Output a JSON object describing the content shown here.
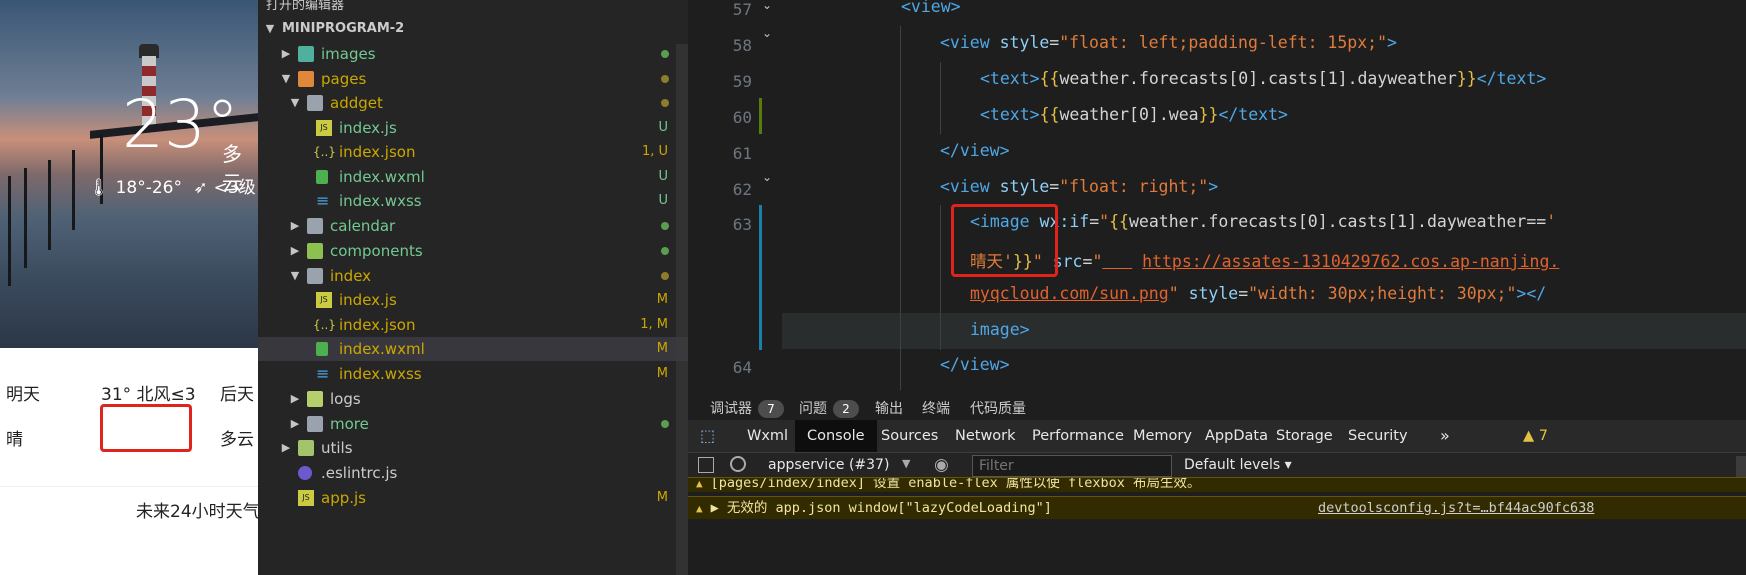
{
  "phone": {
    "temperature": "23°",
    "condition": "多云",
    "range": "18°-26°",
    "wind": "<3级",
    "tomorrow_label": "明天",
    "tomorrow_temp_wind": "31° 北风≤3",
    "dayafter_label": "后天",
    "tomorrow_weather": "晴",
    "dayafter_weather": "多云",
    "hourly_title": "未来24小时天气"
  },
  "explorer": {
    "open_editors": "打开的编辑器",
    "project": "MINIPROGRAM-2",
    "items": [
      {
        "name": "images",
        "badge": ""
      },
      {
        "name": "pages",
        "badge": ""
      },
      {
        "name": "addget",
        "badge": ""
      },
      {
        "name": "index.js",
        "badge": "U"
      },
      {
        "name": "index.json",
        "badge": "1, U"
      },
      {
        "name": "index.wxml",
        "badge": "U"
      },
      {
        "name": "index.wxss",
        "badge": "U"
      },
      {
        "name": "calendar",
        "badge": ""
      },
      {
        "name": "components",
        "badge": ""
      },
      {
        "name": "index",
        "badge": ""
      },
      {
        "name": "index.js",
        "badge": "M"
      },
      {
        "name": "index.json",
        "badge": "1, M"
      },
      {
        "name": "index.wxml",
        "badge": "M"
      },
      {
        "name": "index.wxss",
        "badge": "M"
      },
      {
        "name": "logs",
        "badge": ""
      },
      {
        "name": "more",
        "badge": ""
      },
      {
        "name": "utils",
        "badge": ""
      },
      {
        "name": ".eslintrc.js",
        "badge": ""
      },
      {
        "name": "app.js",
        "badge": "M"
      }
    ],
    "file_icons": {
      "js": "JS",
      "json": "{..}",
      "wxss": "≡"
    }
  },
  "editor": {
    "line_numbers": [
      "57",
      "58",
      "59",
      "60",
      "61",
      "62",
      "63",
      "64"
    ],
    "code": {
      "l57_view": "<view>",
      "l58_open": "<view",
      "l58_attr": "style",
      "l58_val": "\"float: left;padding-left: 15px;\"",
      "l59_text": "<text>",
      "l59_expr": "weather.forecasts[0].casts[1].dayweather",
      "l59_close": "</text>",
      "l60_expr": "weather[0].wea",
      "l61_close": "</view>",
      "l62_val": "\"float: right;\"",
      "l63_image": "<image",
      "l63_wxif": "wx:if",
      "l63_expr": "weather.forecasts[0].casts[1].dayweather==",
      "l63_lit": "'晴天'",
      "l63_src": "src",
      "l63_url1": "https://assates-1310429762.cos.ap-nanjing.",
      "l63_url2": "myqcloud.com/sun.png",
      "l63_style_val": "\"width: 30px;height: 30px;\"",
      "l63_close_a": "</",
      "l63_close_b": "image",
      "l64_close": "</view>",
      "brace_open": "{{",
      "brace_close": "}}",
      "eq": "=",
      "gt": ">",
      "quote": "\""
    }
  },
  "panel": {
    "tabs": [
      {
        "label": "调试器",
        "count": "7"
      },
      {
        "label": "问题",
        "count": "2"
      },
      {
        "label": "输出",
        "count": ""
      },
      {
        "label": "终端",
        "count": ""
      },
      {
        "label": "代码质量",
        "count": ""
      }
    ],
    "devtools_tabs": [
      "Wxml",
      "Console",
      "Sources",
      "Network",
      "Performance",
      "Memory",
      "AppData",
      "Storage",
      "Security"
    ],
    "more": "»",
    "warn_count": "▲ 7",
    "context": "appservice (#37)",
    "filter_placeholder": "Filter",
    "levels": "Default levels",
    "logs": [
      {
        "text": "[pages/index/index] 设置 enable-flex 属性以使 flexbox 布局生效。",
        "source": ""
      },
      {
        "text": "▶ 无效的 app.json window[\"lazyCodeLoading\"]",
        "source": "devtoolsconfig.js?t=…bf44ac90fc638"
      }
    ]
  }
}
